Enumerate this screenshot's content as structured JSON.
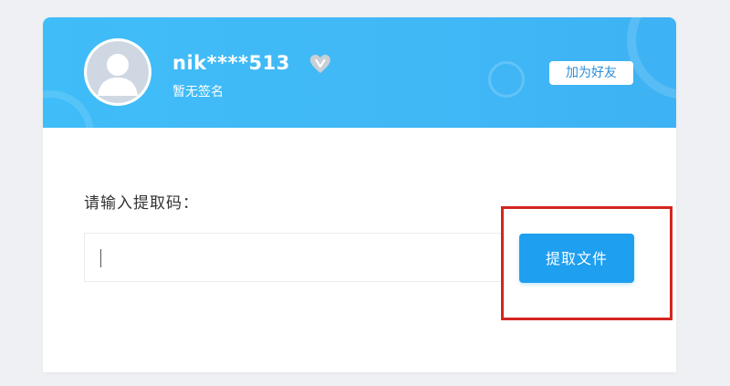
{
  "profile": {
    "username": "nik****513",
    "signature": "暂无签名",
    "add_friend_label": "加为好友",
    "avatar_icon": "default-user-avatar",
    "badge_icon": "vip-heart-icon"
  },
  "extract": {
    "prompt_label": "请输入提取码：",
    "input_value": "",
    "button_label": "提取文件"
  },
  "colors": {
    "header_bg": "#41b8f6",
    "button_bg": "#1f9ff0",
    "highlight_border": "#d4251f",
    "text_dark": "#333333"
  }
}
